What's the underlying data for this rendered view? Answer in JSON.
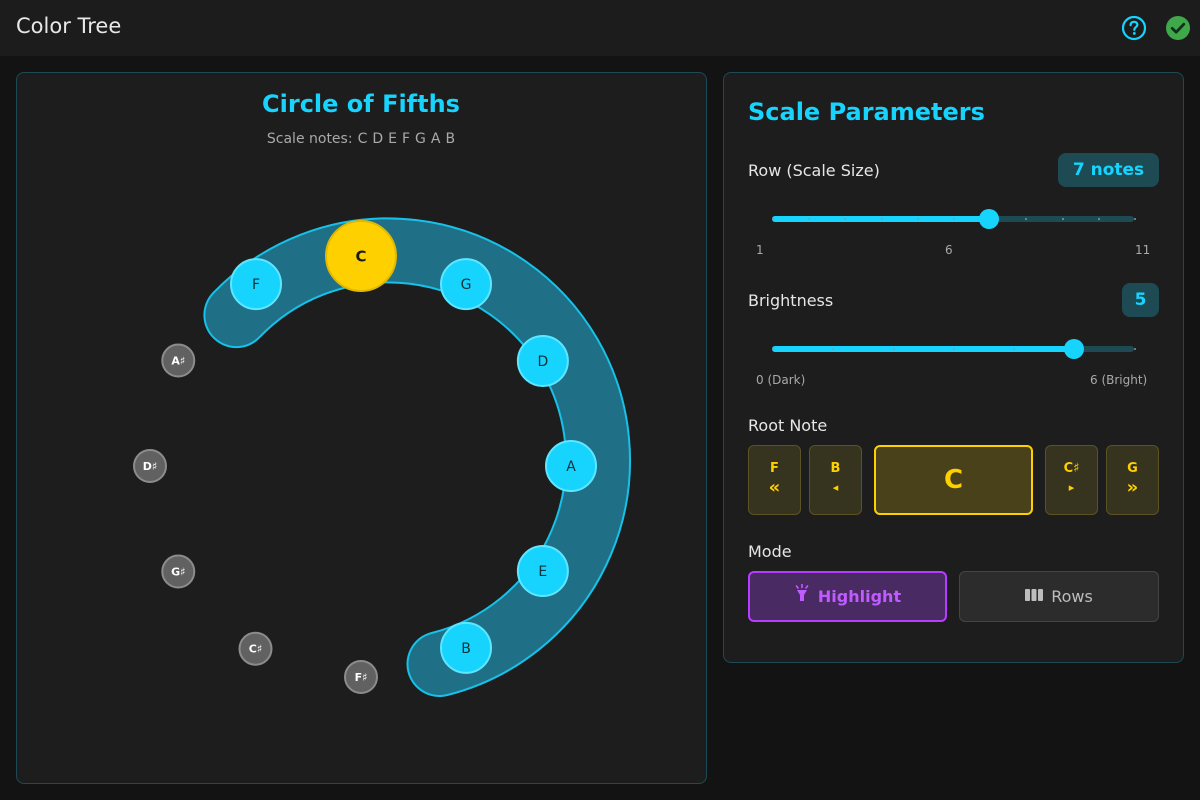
{
  "app": {
    "title": "Color Tree"
  },
  "titlebar": {
    "help_icon": "help-circle-icon",
    "confirm_icon": "check-circle-icon"
  },
  "colors": {
    "accent": "#17d4ff",
    "root": "#ffd000",
    "highlight": "#b63cff",
    "inactive_note": "#616161"
  },
  "circle": {
    "title": "Circle of Fifths",
    "scale_label": "Scale notes:",
    "scale_notes": [
      "C",
      "D",
      "E",
      "F",
      "G",
      "A",
      "B"
    ],
    "notes": [
      {
        "name": "C",
        "state": "root"
      },
      {
        "name": "G",
        "state": "in-scale"
      },
      {
        "name": "D",
        "state": "in-scale"
      },
      {
        "name": "A",
        "state": "in-scale"
      },
      {
        "name": "E",
        "state": "in-scale"
      },
      {
        "name": "B",
        "state": "in-scale"
      },
      {
        "name": "F♯",
        "state": "out"
      },
      {
        "name": "C♯",
        "state": "out"
      },
      {
        "name": "G♯",
        "state": "out"
      },
      {
        "name": "D♯",
        "state": "out"
      },
      {
        "name": "A♯",
        "state": "out"
      },
      {
        "name": "F",
        "state": "in-scale"
      }
    ]
  },
  "params": {
    "title": "Scale Parameters",
    "row": {
      "label": "Row (Scale Size)",
      "badge": "7 notes",
      "value": 7,
      "min": 1,
      "max": 11,
      "min_label": "1",
      "mid_label": "6",
      "max_label": "11"
    },
    "brightness": {
      "label": "Brightness",
      "badge": "5",
      "value": 5,
      "min": 0,
      "max": 6,
      "min_label": "0 (Dark)",
      "max_label": "6 (Bright)"
    },
    "root": {
      "label": "Root Note",
      "current": "C",
      "prev2": {
        "name": "F",
        "arrow": "«",
        "icon": "double-chevron-left-icon"
      },
      "prev1": {
        "name": "B",
        "arrow": "◂",
        "icon": "triangle-left-icon"
      },
      "next1": {
        "name": "C♯",
        "arrow": "▸",
        "icon": "triangle-right-icon"
      },
      "next2": {
        "name": "G",
        "arrow": "»",
        "icon": "double-chevron-right-icon"
      }
    },
    "mode": {
      "label": "Mode",
      "selected": "Highlight",
      "highlight_label": "Highlight",
      "highlight_icon": "flashlight-icon",
      "rows_label": "Rows",
      "rows_icon": "columns-icon"
    }
  }
}
